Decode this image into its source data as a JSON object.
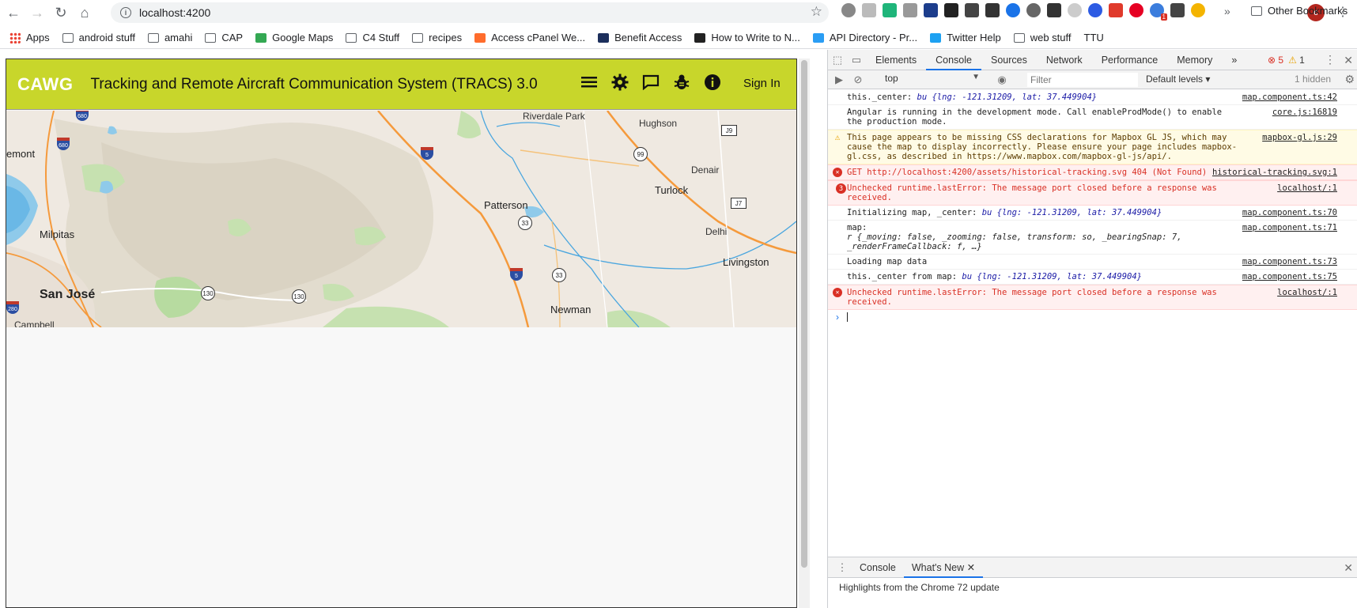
{
  "browser": {
    "url": "localhost:4200",
    "bookmarks": [
      {
        "label": "Apps",
        "icon": "apps-icon"
      },
      {
        "label": "android stuff",
        "icon": "folder-icon"
      },
      {
        "label": "amahi",
        "icon": "folder-icon"
      },
      {
        "label": "CAP",
        "icon": "folder-icon"
      },
      {
        "label": "Google Maps",
        "icon": "google-maps-icon"
      },
      {
        "label": "C4 Stuff",
        "icon": "folder-icon"
      },
      {
        "label": "recipes",
        "icon": "folder-icon"
      },
      {
        "label": "Access cPanel We...",
        "icon": "cpanel-icon"
      },
      {
        "label": "Benefit Access",
        "icon": "ms-icon"
      },
      {
        "label": "How to Write to N...",
        "icon": "htg-icon"
      },
      {
        "label": "API Directory - Pr...",
        "icon": "api-icon"
      },
      {
        "label": "Twitter Help",
        "icon": "twitter-icon"
      },
      {
        "label": "web stuff",
        "icon": "folder-icon"
      },
      {
        "label": "TTU",
        "icon": "none"
      }
    ],
    "other_bookmarks": "Other Bookmarks",
    "more_bookmarks": "»",
    "profile_initial": "c",
    "ext_badge": "1"
  },
  "app": {
    "logo": "CAWG",
    "title": "Tracking and Remote Aircraft Communication System (TRACS) 3.0",
    "sign_in": "Sign In",
    "header_color": "#c8d62b"
  },
  "map": {
    "places": [
      {
        "name": "Riverdale Park",
        "cls": ""
      },
      {
        "name": "Hughson",
        "cls": ""
      },
      {
        "name": "Denair",
        "cls": ""
      },
      {
        "name": "Turlock",
        "cls": "mid"
      },
      {
        "name": "Patterson",
        "cls": "mid"
      },
      {
        "name": "Delhi",
        "cls": ""
      },
      {
        "name": "Livingston",
        "cls": "mid"
      },
      {
        "name": "Newman",
        "cls": "mid"
      },
      {
        "name": "Milpitas",
        "cls": "mid"
      },
      {
        "name": "San José",
        "cls": "big"
      },
      {
        "name": "Campbell",
        "cls": ""
      },
      {
        "name": "emont",
        "cls": "mid"
      }
    ],
    "routes": [
      "680",
      "680",
      "5",
      "5",
      "99",
      "J9",
      "J7",
      "33",
      "33",
      "130",
      "130",
      "280"
    ]
  },
  "devtools": {
    "tabs": [
      "Elements",
      "Console",
      "Sources",
      "Network",
      "Performance",
      "Memory"
    ],
    "active_tab": "Console",
    "more_tabs": "»",
    "error_count": "5",
    "warning_count": "1",
    "context": "top",
    "filter_placeholder": "Filter",
    "levels": "Default levels ▾",
    "hidden": "1 hidden",
    "logs": [
      {
        "level": "info",
        "prefix": "this._center: ",
        "obj": "bu {lng: -121.31209, lat: 37.449904}",
        "text": "",
        "src": "map.component.ts:42"
      },
      {
        "level": "info",
        "prefix": "",
        "obj": "",
        "text": "Angular is running in the development mode. Call enableProdMode() to enable the production mode.",
        "src": "core.js:16819"
      },
      {
        "level": "warn",
        "prefix": "",
        "obj": "",
        "text": "This page appears to be missing CSS declarations for Mapbox GL JS, which may cause the map to display incorrectly. Please ensure your page includes mapbox-gl.css, as described in https://www.mapbox.com/mapbox-gl-js/api/.",
        "src": "mapbox-gl.js:29"
      },
      {
        "level": "error",
        "prefix": "GET ",
        "obj": "",
        "text": "http://localhost:4200/assets/historical-tracking.svg 404 (Not Found)",
        "src": "historical-tracking.svg:1",
        "count": ""
      },
      {
        "level": "error",
        "prefix": "",
        "obj": "",
        "text": "Unchecked runtime.lastError: The message port closed before a response was received.",
        "src": "localhost/:1",
        "count": "3"
      },
      {
        "level": "info",
        "prefix": "Initializing map, _center: ",
        "obj": "bu {lng: -121.31209, lat: 37.449904}",
        "text": "",
        "src": "map.component.ts:70"
      },
      {
        "level": "info",
        "prefix": "map:",
        "obj": "",
        "text": "r {_moving: false, _zooming: false, transform: so, _bearingSnap: 7, _renderFrameCallback: f, …}",
        "src": "map.component.ts:71"
      },
      {
        "level": "info",
        "prefix": "",
        "obj": "",
        "text": "Loading map data",
        "src": "map.component.ts:73"
      },
      {
        "level": "info",
        "prefix": "this._center from map: ",
        "obj": "bu {lng: -121.31209, lat: 37.449904}",
        "text": "",
        "src": "map.component.ts:75"
      },
      {
        "level": "error",
        "prefix": "",
        "obj": "",
        "text": "Unchecked runtime.lastError: The message port closed before a response was received.",
        "src": "localhost/:1",
        "count": ""
      }
    ],
    "drawer_tabs": [
      "Console",
      "What's New"
    ],
    "drawer_active": "What's New",
    "drawer_text": "Highlights from the Chrome 72 update"
  }
}
